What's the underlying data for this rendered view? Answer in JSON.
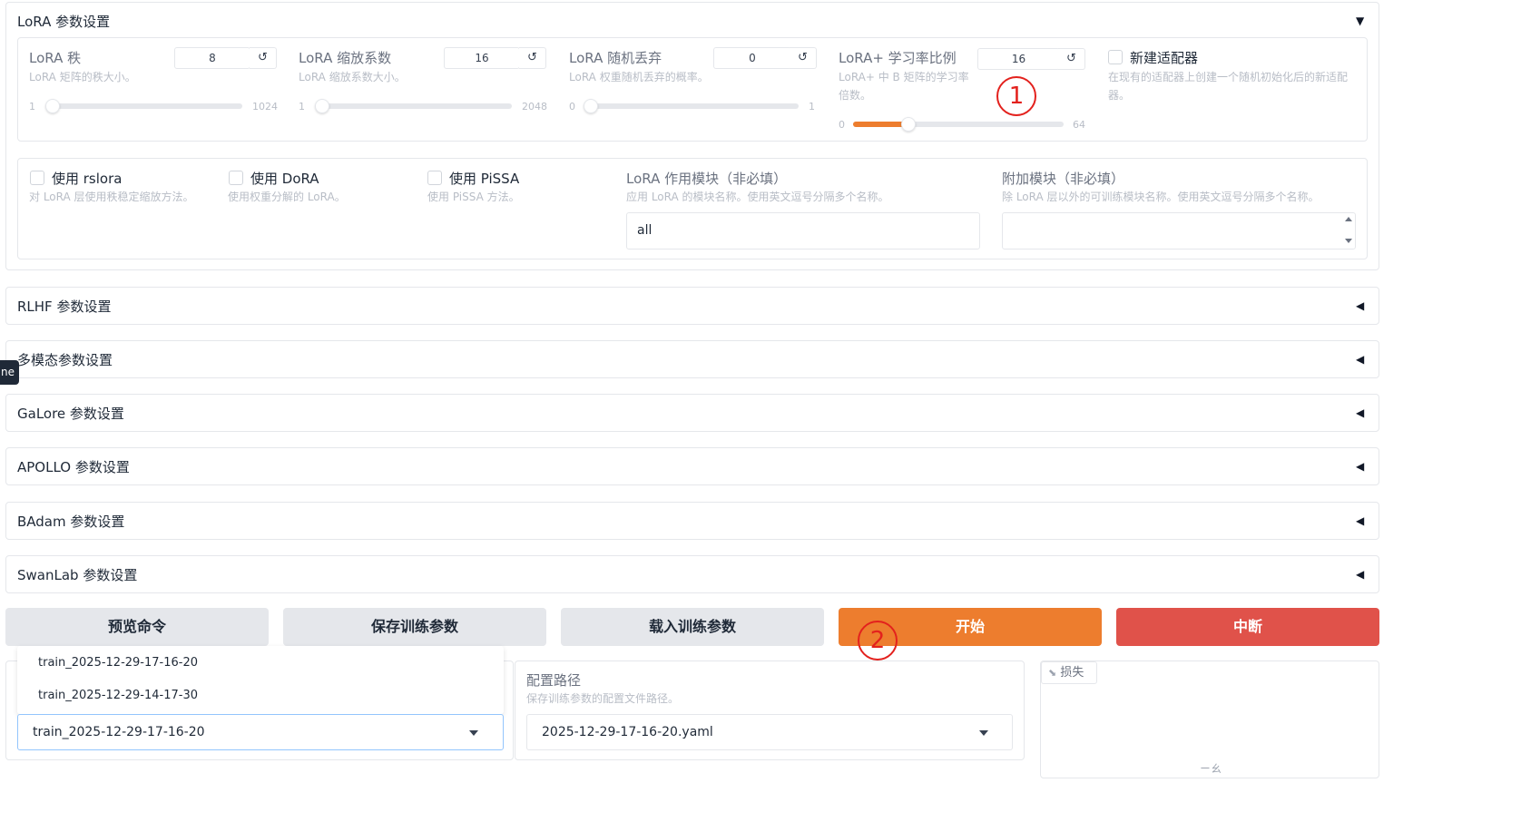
{
  "lora_section": {
    "title": "LoRA 参数设置",
    "arrow": "▼",
    "lora_rank": {
      "label": "LoRA 秩",
      "info": "LoRA 矩阵的秩大小。",
      "value": "8",
      "min": "1",
      "max": "1024",
      "level": 0.007
    },
    "lora_alpha": {
      "label": "LoRA 缩放系数",
      "info": "LoRA 缩放系数大小。",
      "value": "16",
      "min": "1",
      "max": "2048",
      "level": 0.007
    },
    "lora_dropout": {
      "label": "LoRA 随机丢弃",
      "info": "LoRA 权重随机丢弃的概率。",
      "value": "0",
      "min": "0",
      "max": "1",
      "level": 0
    },
    "loraplus_lr_ratio": {
      "label": "LoRA+ 学习率比例",
      "info": "LoRA+ 中 B 矩阵的学习率倍数。",
      "value": "16",
      "min": "0",
      "max": "64",
      "level": 0.25
    },
    "create_new_adapter": {
      "label": "新建适配器",
      "info": "在现有的适配器上创建一个随机初始化后的新适配器。"
    },
    "reset_icon": "↺",
    "use_rslora": {
      "label": "使用 rslora",
      "info": "对 LoRA 层使用秩稳定缩放方法。"
    },
    "use_dora": {
      "label": "使用 DoRA",
      "info": "使用权重分解的 LoRA。"
    },
    "use_pissa": {
      "label": "使用 PiSSA",
      "info": "使用 PiSSA 方法。"
    },
    "lora_target": {
      "label": "LoRA 作用模块（非必填）",
      "info": "应用 LoRA 的模块名称。使用英文逗号分隔多个名称。",
      "value": "all"
    },
    "additional_target": {
      "label": "附加模块（非必填）",
      "info": "除 LoRA 层以外的可训练模块名称。使用英文逗号分隔多个名称。",
      "value": ""
    }
  },
  "accordions": [
    {
      "title": "RLHF 参数设置",
      "arrow": "◀"
    },
    {
      "title": "多模态参数设置",
      "arrow": "◀"
    },
    {
      "title": "GaLore 参数设置",
      "arrow": "◀"
    },
    {
      "title": "APOLLO 参数设置",
      "arrow": "◀"
    },
    {
      "title": "BAdam 参数设置",
      "arrow": "◀"
    },
    {
      "title": "SwanLab 参数设置",
      "arrow": "◀"
    }
  ],
  "side_tab": "ne",
  "buttons": {
    "preview": "预览命令",
    "save_args": "保存训练参数",
    "load_args": "载入训练参数",
    "start": "开始",
    "abort": "中断"
  },
  "annotations": {
    "one": "1",
    "two": "2"
  },
  "output_dir": {
    "options": [
      "train_2025-12-29-17-16-20",
      "train_2025-12-29-14-17-30"
    ],
    "selected": "train_2025-12-29-17-16-20"
  },
  "config_path": {
    "label": "配置路径",
    "info": "保存训练参数的配置文件路径。",
    "selected": "2025-12-29-17-16-20.yaml"
  },
  "loss_plot": {
    "label": "损失",
    "icon": "chart-icon",
    "placeholder_text": "ㄧㄠ"
  },
  "colors": {
    "accent": "#ed7d2e",
    "danger": "#e0524a",
    "annotation": "#e3211d"
  }
}
